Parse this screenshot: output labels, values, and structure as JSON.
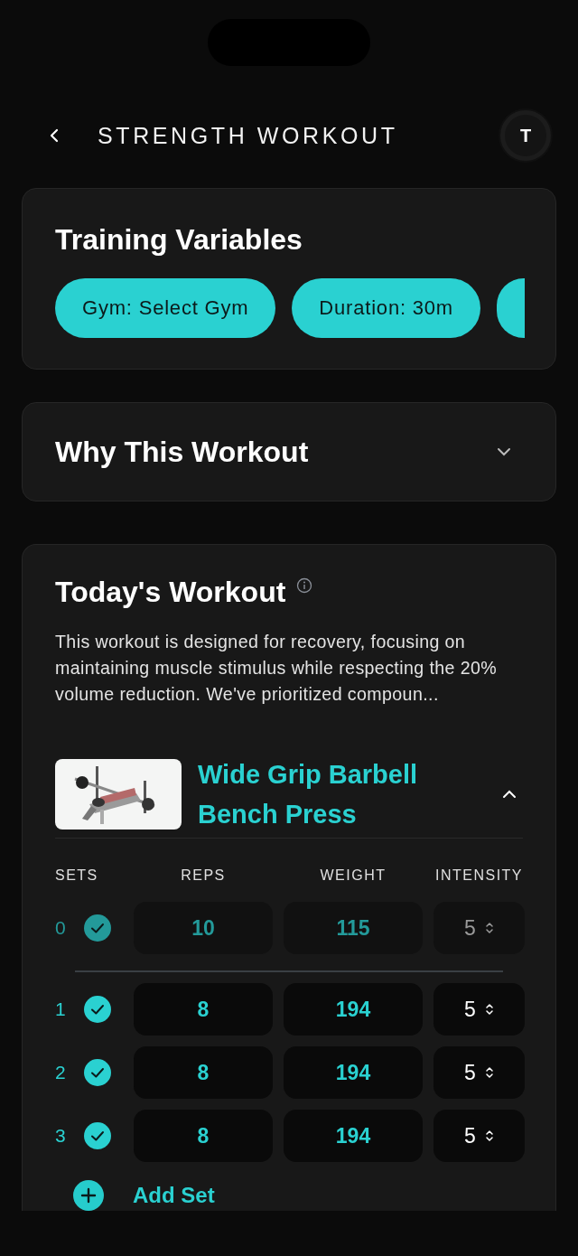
{
  "header": {
    "title": "STRENGTH WORKOUT",
    "avatar": "T"
  },
  "training_variables": {
    "title": "Training Variables",
    "chips": [
      {
        "kind": "full",
        "label": "Gym: Select Gym"
      },
      {
        "kind": "full",
        "label": "Duration: 30m"
      },
      {
        "kind": "partial"
      }
    ]
  },
  "why_section": {
    "title": "Why This Workout",
    "expanded": false
  },
  "todays_workout": {
    "title": "Today's Workout",
    "description": "This workout is designed for recovery, focusing on maintaining muscle stimulus while respecting the 20% volume reduction. We've prioritized compoun...",
    "exercise": {
      "name": "Wide Grip Barbell Bench Press",
      "expanded": true,
      "columns": [
        "SETS",
        "REPS",
        "WEIGHT",
        "INTENSITY"
      ],
      "sets": [
        {
          "number": "0",
          "kind": "warmup",
          "checked": true,
          "reps": "10",
          "weight": "115",
          "intensity": "5"
        },
        {
          "number": "1",
          "kind": "working",
          "checked": true,
          "reps": "8",
          "weight": "194",
          "intensity": "5"
        },
        {
          "number": "2",
          "kind": "working",
          "checked": true,
          "reps": "8",
          "weight": "194",
          "intensity": "5"
        },
        {
          "number": "3",
          "kind": "working",
          "checked": true,
          "reps": "8",
          "weight": "194",
          "intensity": "5"
        }
      ],
      "add_set": "Add Set"
    }
  }
}
